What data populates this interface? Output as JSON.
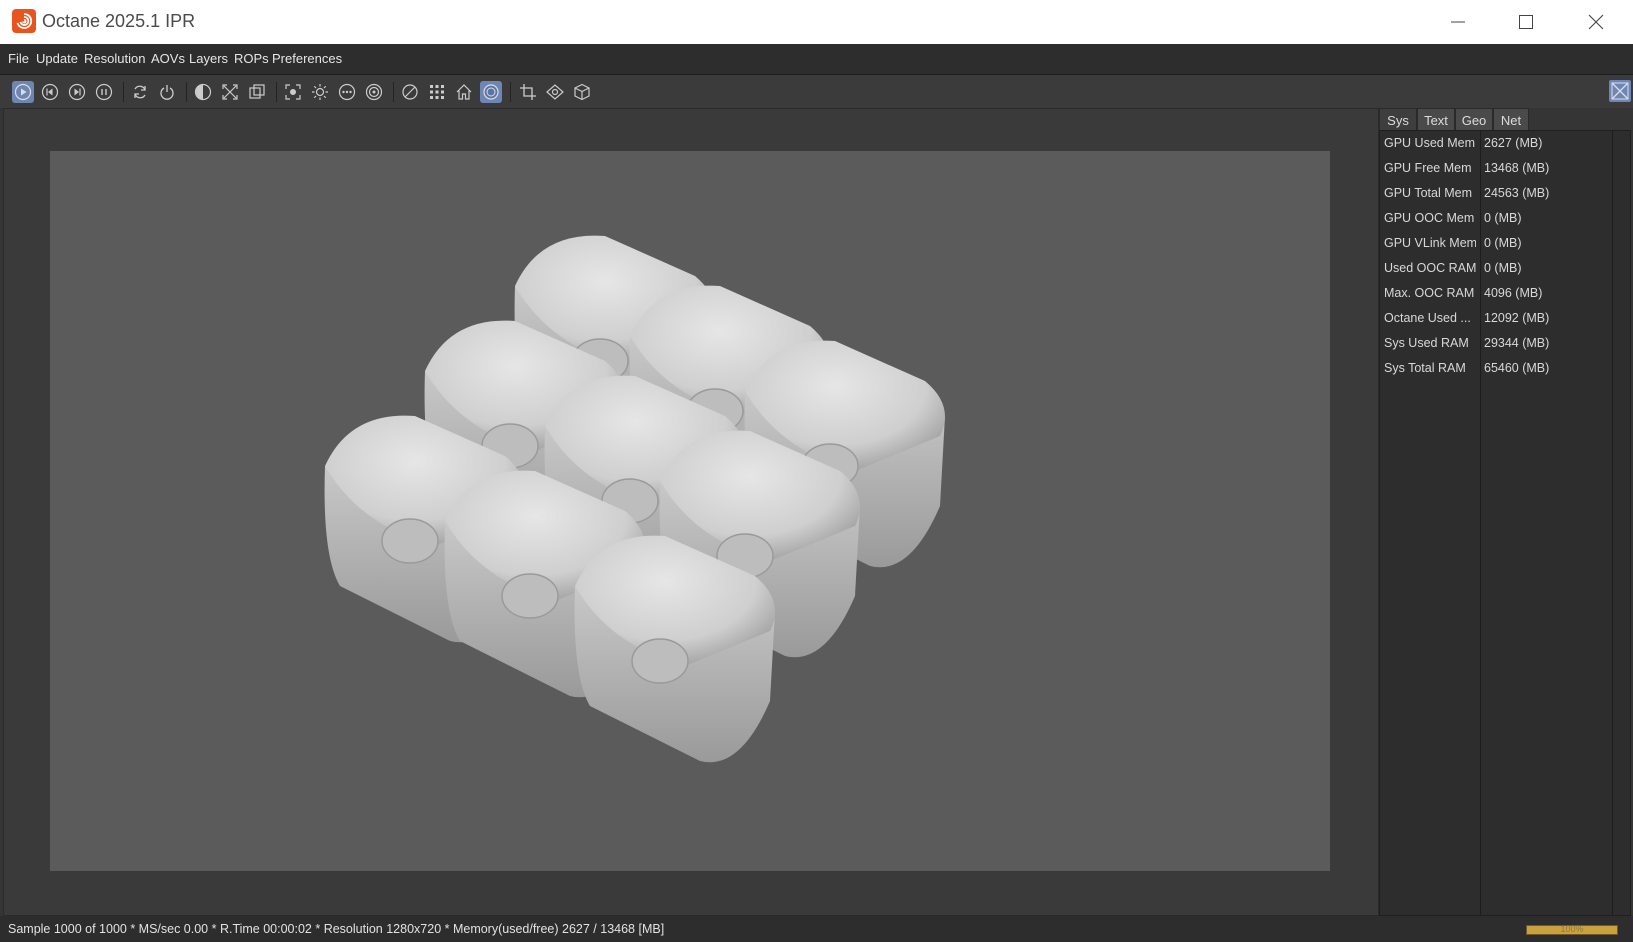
{
  "window": {
    "title": "Octane 2025.1 IPR"
  },
  "menu": [
    "File",
    "Update",
    "Resolution",
    "AOVs",
    "Layers",
    "ROPs",
    "Preferences"
  ],
  "toolbar": {
    "icons": [
      "play-render-icon",
      "restart-render-icon",
      "step-render-icon",
      "pause-render-icon",
      "refresh-icon",
      "power-icon",
      "contrast-icon",
      "fit-to-view-icon",
      "region-render-icon",
      "focus-picker-icon",
      "light-icon",
      "more-options-icon",
      "target-icon",
      "clay-mode-icon",
      "grid-icon",
      "home-icon",
      "environment-toggle-icon",
      "crop-icon",
      "camera-view-icon",
      "object-icon"
    ],
    "active": [
      "play-render-icon",
      "environment-toggle-icon"
    ]
  },
  "stats": {
    "tabs": [
      "Sys",
      "Text",
      "Geo",
      "Net"
    ],
    "active_tab": "Sys",
    "rows": [
      {
        "label": "GPU Used Mem",
        "value": "2627 (MB)"
      },
      {
        "label": "GPU Free Mem",
        "value": "13468 (MB)"
      },
      {
        "label": "GPU Total Mem",
        "value": "24563 (MB)"
      },
      {
        "label": "GPU OOC Mem",
        "value": "0 (MB)"
      },
      {
        "label": "GPU VLink Mem",
        "value": "0 (MB)"
      },
      {
        "label": "Used OOC RAM",
        "value": "0 (MB)"
      },
      {
        "label": "Max. OOC RAM",
        "value": "4096 (MB)"
      },
      {
        "label": "Octane Used ...",
        "value": "12092 (MB)"
      },
      {
        "label": "Sys Used RAM",
        "value": "29344 (MB)"
      },
      {
        "label": "Sys Total RAM",
        "value": "65460 (MB)"
      }
    ]
  },
  "status": {
    "text": "Sample 1000 of 1000 * MS/sec 0.00 * R.Time 00:00:02 * Resolution 1280x720 * Memory(used/free) 2627 / 13468 [MB]",
    "progress_label": "100%",
    "progress": 1.0
  },
  "colors": {
    "accent": "#6d86b3",
    "progress": "#c9a13f",
    "app_icon": "#e8541f"
  }
}
